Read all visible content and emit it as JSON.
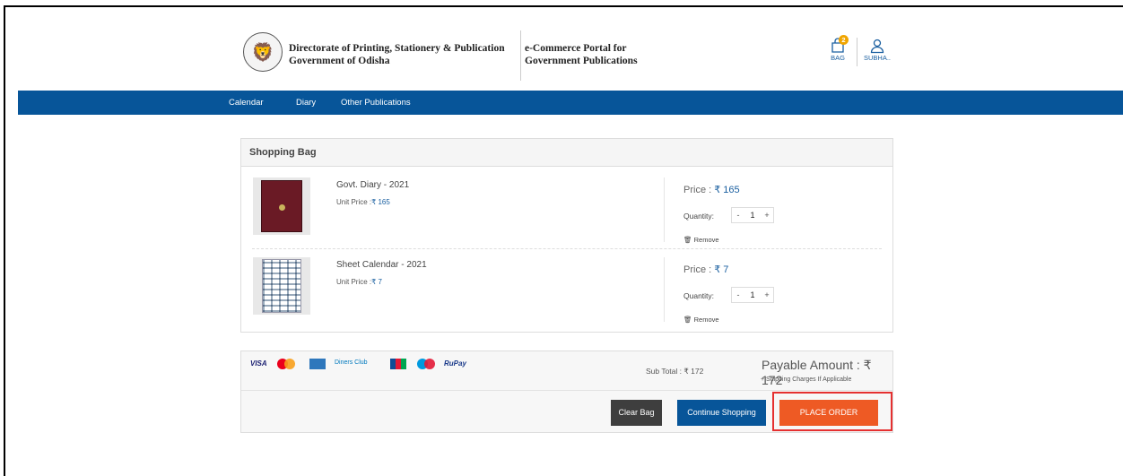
{
  "header": {
    "org_line1": "Directorate of Printing, Stationery & Publication",
    "org_line2": "Government of Odisha",
    "portal_line1": "e-Commerce Portal for",
    "portal_line2": "Government Publications",
    "bag_count": "2",
    "bag_label": "BAG",
    "user_label": "SUBHA..",
    "accent": "#075599"
  },
  "nav": {
    "items": [
      "Calendar",
      "Diary",
      "Other Publications"
    ]
  },
  "cart": {
    "title": "Shopping Bag",
    "unit_price_label": "Unit Price :",
    "price_label": "Price :",
    "quantity_label": "Quantity:",
    "remove_label": "🗑 Remove",
    "items": [
      {
        "name": "Govt. Diary - 2021",
        "unit_price": "₹ 165",
        "price": "₹ 165",
        "quantity": "1"
      },
      {
        "name": "Sheet Calendar - 2021",
        "unit_price": "₹ 7",
        "price": "₹ 7",
        "quantity": "1"
      }
    ]
  },
  "summary": {
    "cards": [
      "VISA",
      "Mastercard",
      "AmEx",
      "Diners Club",
      "JCB",
      "Maestro",
      "RuPay"
    ],
    "subtotal_label": "Sub Total :",
    "subtotal": "₹ 172",
    "payable_label": "Payable Amount :",
    "payable": "₹ 172",
    "shipping_note": "+ Shipping Charges If Applicable",
    "clear_label": "Clear Bag",
    "continue_label": "Continue Shopping",
    "place_label": "PLACE ORDER",
    "place_color": "#ee5a24"
  }
}
